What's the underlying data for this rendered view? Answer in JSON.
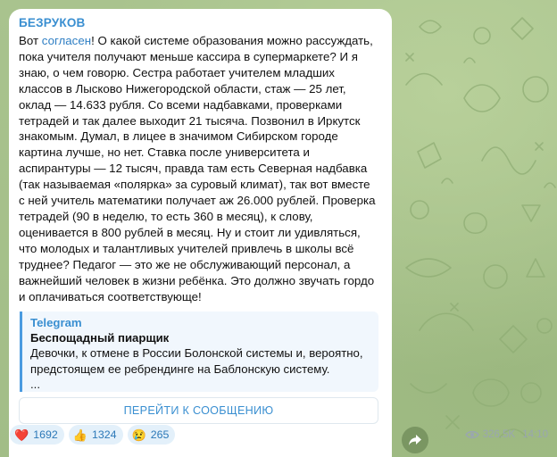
{
  "post": {
    "author": "БЕЗРУКОВ",
    "text_before_link": "Вот ",
    "link_text": "согласен",
    "text_after_link": "! О какой системе образования можно рассуждать, пока учителя получают меньше кассира в супермаркете? И я знаю, о чем говорю. Сестра работает учителем младших классов в Лысково Нижегородской области, стаж — 25 лет, оклад — 14.633 рубля. Со всеми надбавками, проверками тетрадей и так далее выходит 21 тысяча. Позвонил в Иркутск знакомым. Думал, в лицее в значимом Сибирском городе картина лучше, но нет. Ставка после университета и аспирантуры — 12 тысяч, правда там есть Северная надбавка (так называемая «полярка» за суровый климат), так вот вместе с ней учитель математики получает аж 26.000 рублей. Проверка тетрадей (90 в неделю, то есть 360 в месяц), к слову, оценивается в 800 рублей в месяц. Ну и стоит ли удивляться, что молодых и талантливых учителей привлечь в школы всё труднее? Педагог — это же не обслуживающий персонал, а важнейший человек в жизни ребёнка. Это должно звучать гордо и оплачиваться соответствующе!"
  },
  "forward": {
    "source": "Telegram",
    "title": "Беспощадный пиарщик",
    "text": "Девочки, к отмене в России Болонской системы и, вероятно, предстоящем ее ребрендинге на Баблонскую систему.",
    "ellipsis": "..."
  },
  "goto_button": "ПЕРЕЙТИ К СООБЩЕНИЮ",
  "reactions": [
    {
      "emoji": "❤️",
      "icon": "heart-icon",
      "count": "1692"
    },
    {
      "emoji": "👍",
      "icon": "thumbs-up-icon",
      "count": "1324"
    },
    {
      "emoji": "😢",
      "icon": "crying-face-icon",
      "count": "265"
    }
  ],
  "meta": {
    "views": "326.5K",
    "time": "14:10"
  },
  "colors": {
    "accent": "#3a8fd1",
    "bubble": "#ffffff",
    "wallpaper": "#a7c18e",
    "reaction_bg": "#e3f0fa"
  }
}
